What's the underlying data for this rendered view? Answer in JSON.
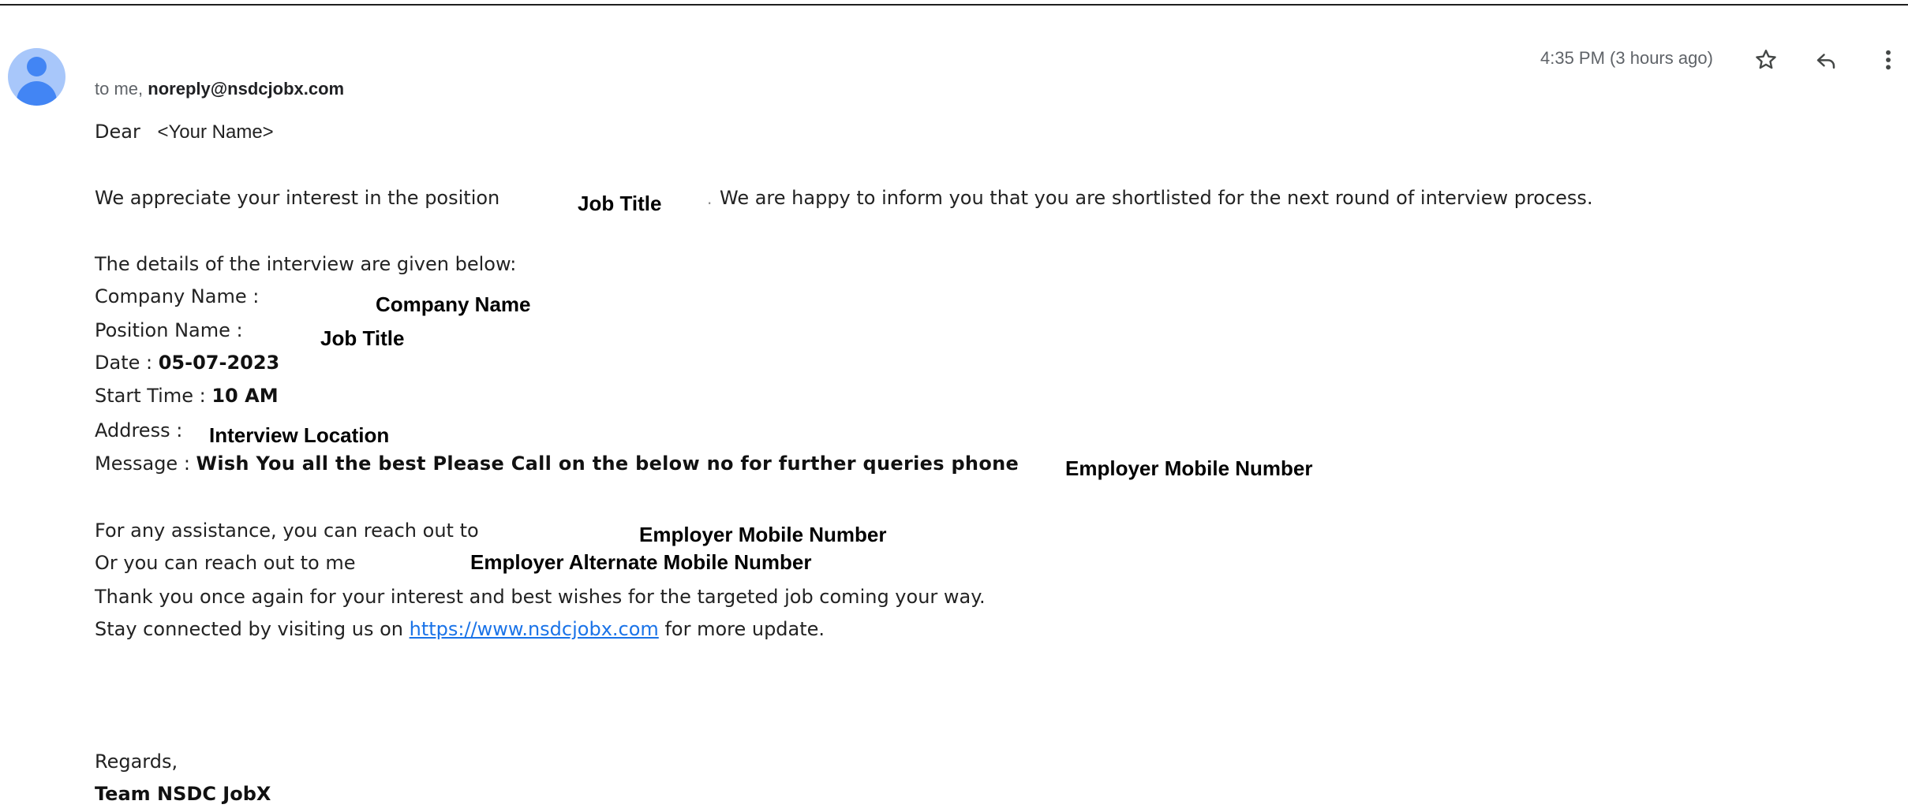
{
  "header": {
    "recipient_prefix": "to me,",
    "sender_email": "noreply@nsdcjobx.com",
    "timestamp": "4:35 PM (3 hours ago)",
    "icons": [
      "star-icon",
      "reply-icon",
      "more-vert-icon"
    ]
  },
  "body": {
    "greeting": "Dear",
    "recipient_name": "<Your Name>",
    "intro_prefix": "We appreciate your interest in the position",
    "intro_job_title": "Job Title",
    "intro_suffix": "We are happy to inform you that you are shortlisted for the next round of interview process.",
    "details_heading": "The details of the interview are given below:",
    "company_label": "Company Name :",
    "company_value": "Company Name",
    "position_label": "Position Name :",
    "position_value": "Job Title",
    "date_label": "Date :",
    "date_value": "05-07-2023",
    "start_time_label": "Start Time :",
    "start_time_value": "10 AM",
    "address_label": "Address :",
    "address_value": "Interview Location",
    "message_label": "Message :",
    "message_value": "Wish You all the best Please Call on the below no for further queries phone",
    "message_phone": "Employer Mobile Number",
    "assistance_text": "For any assistance, you can reach out to",
    "assistance_value": "Employer Mobile Number",
    "alternate_text": "Or you can reach out to me",
    "alternate_value": "Employer Alternate Mobile Number",
    "thanks_line": "Thank you once again for your interest and best wishes for the targeted job coming your way.",
    "connect_prefix": "Stay connected by visiting us on",
    "connect_link": "https://www.nsdcjobx.com",
    "connect_suffix": "for more update.",
    "regards": "Regards,",
    "signature": "Team NSDC JobX"
  },
  "colors": {
    "link": "#1a73e8",
    "avatar_bg": "#a8c7fa",
    "avatar_fg": "#4285f4",
    "meta_text": "#5f6368"
  }
}
